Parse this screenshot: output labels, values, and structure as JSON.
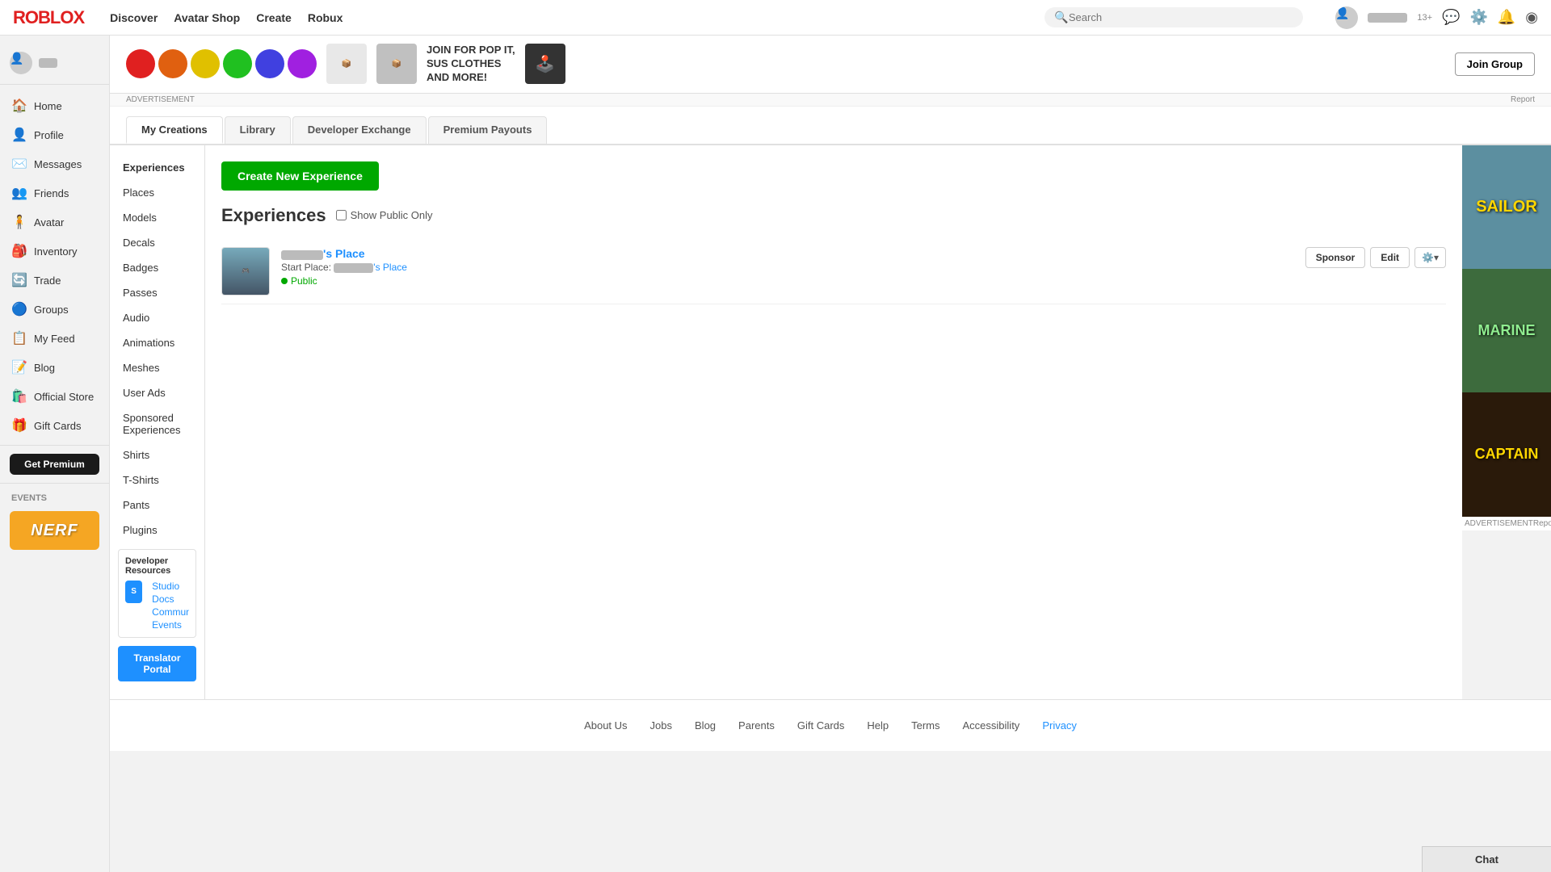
{
  "app": {
    "logo": "ROBLOX",
    "nav_links": [
      "Discover",
      "Avatar Shop",
      "Create",
      "Robux"
    ],
    "search_placeholder": "Search",
    "user_age": "13+",
    "username": "redacted"
  },
  "sidebar": {
    "items": [
      {
        "id": "home",
        "label": "Home",
        "icon": "🏠"
      },
      {
        "id": "profile",
        "label": "Profile",
        "icon": "👤"
      },
      {
        "id": "messages",
        "label": "Messages",
        "icon": "✉️"
      },
      {
        "id": "friends",
        "label": "Friends",
        "icon": "👥"
      },
      {
        "id": "avatar",
        "label": "Avatar",
        "icon": "🧍"
      },
      {
        "id": "inventory",
        "label": "Inventory",
        "icon": "🎒"
      },
      {
        "id": "trade",
        "label": "Trade",
        "icon": "🔄"
      },
      {
        "id": "groups",
        "label": "Groups",
        "icon": "🔵"
      },
      {
        "id": "my_feed",
        "label": "My Feed",
        "icon": "📋"
      },
      {
        "id": "blog",
        "label": "Blog",
        "icon": "📝"
      },
      {
        "id": "official_store",
        "label": "Official Store",
        "icon": "🛍️"
      },
      {
        "id": "gift_cards",
        "label": "Gift Cards",
        "icon": "🎁"
      }
    ],
    "get_premium": "Get Premium",
    "events_label": "Events"
  },
  "ad_banner": {
    "text1": "JOIN FOR POP IT,",
    "text2": "SUS CLOTHES",
    "text3": "AND MORE!",
    "join_btn": "Join Group",
    "advertisement_label": "ADVERTISEMENT",
    "report_label": "Report"
  },
  "tabs": [
    {
      "id": "my_creations",
      "label": "My Creations",
      "active": true
    },
    {
      "id": "library",
      "label": "Library",
      "active": false
    },
    {
      "id": "developer_exchange",
      "label": "Developer Exchange",
      "active": false
    },
    {
      "id": "premium_payouts",
      "label": "Premium Payouts",
      "active": false
    }
  ],
  "create_sidebar": {
    "items": [
      {
        "id": "experiences",
        "label": "Experiences",
        "active": true
      },
      {
        "id": "places",
        "label": "Places"
      },
      {
        "id": "models",
        "label": "Models"
      },
      {
        "id": "decals",
        "label": "Decals"
      },
      {
        "id": "badges",
        "label": "Badges"
      },
      {
        "id": "passes",
        "label": "Passes"
      },
      {
        "id": "audio",
        "label": "Audio"
      },
      {
        "id": "animations",
        "label": "Animations"
      },
      {
        "id": "meshes",
        "label": "Meshes"
      },
      {
        "id": "user_ads",
        "label": "User Ads"
      },
      {
        "id": "sponsored_experiences",
        "label": "Sponsored Experiences"
      },
      {
        "id": "shirts",
        "label": "Shirts"
      },
      {
        "id": "t_shirts",
        "label": "T-Shirts"
      },
      {
        "id": "pants",
        "label": "Pants"
      },
      {
        "id": "plugins",
        "label": "Plugins"
      }
    ],
    "developer_resources_title": "Developer Resources",
    "dev_links": [
      "Studio",
      "Docs",
      "Community",
      "Events"
    ],
    "translator_btn": "Translator Portal"
  },
  "create_main": {
    "create_btn": "Create New Experience",
    "experiences_title": "Experiences",
    "show_public_label": "Show Public Only",
    "experience": {
      "name": "'s Place",
      "start_place_label": "Start Place:",
      "start_place_name": "'s Place",
      "status": "Public",
      "sponsor_btn": "Sponsor",
      "edit_btn": "Edit"
    }
  },
  "right_ad": {
    "sections": [
      "SAILOR",
      "MARINE",
      "CAPTAIN"
    ],
    "advertisement_label": "ADVERTISEMENT",
    "report_label": "Report"
  },
  "footer": {
    "links": [
      {
        "id": "about_us",
        "label": "About Us"
      },
      {
        "id": "jobs",
        "label": "Jobs"
      },
      {
        "id": "blog",
        "label": "Blog"
      },
      {
        "id": "parents",
        "label": "Parents"
      },
      {
        "id": "gift_cards",
        "label": "Gift Cards"
      },
      {
        "id": "help",
        "label": "Help"
      },
      {
        "id": "terms",
        "label": "Terms"
      },
      {
        "id": "accessibility",
        "label": "Accessibility"
      },
      {
        "id": "privacy",
        "label": "Privacy",
        "active": true
      }
    ]
  },
  "chat": {
    "label": "Chat"
  }
}
